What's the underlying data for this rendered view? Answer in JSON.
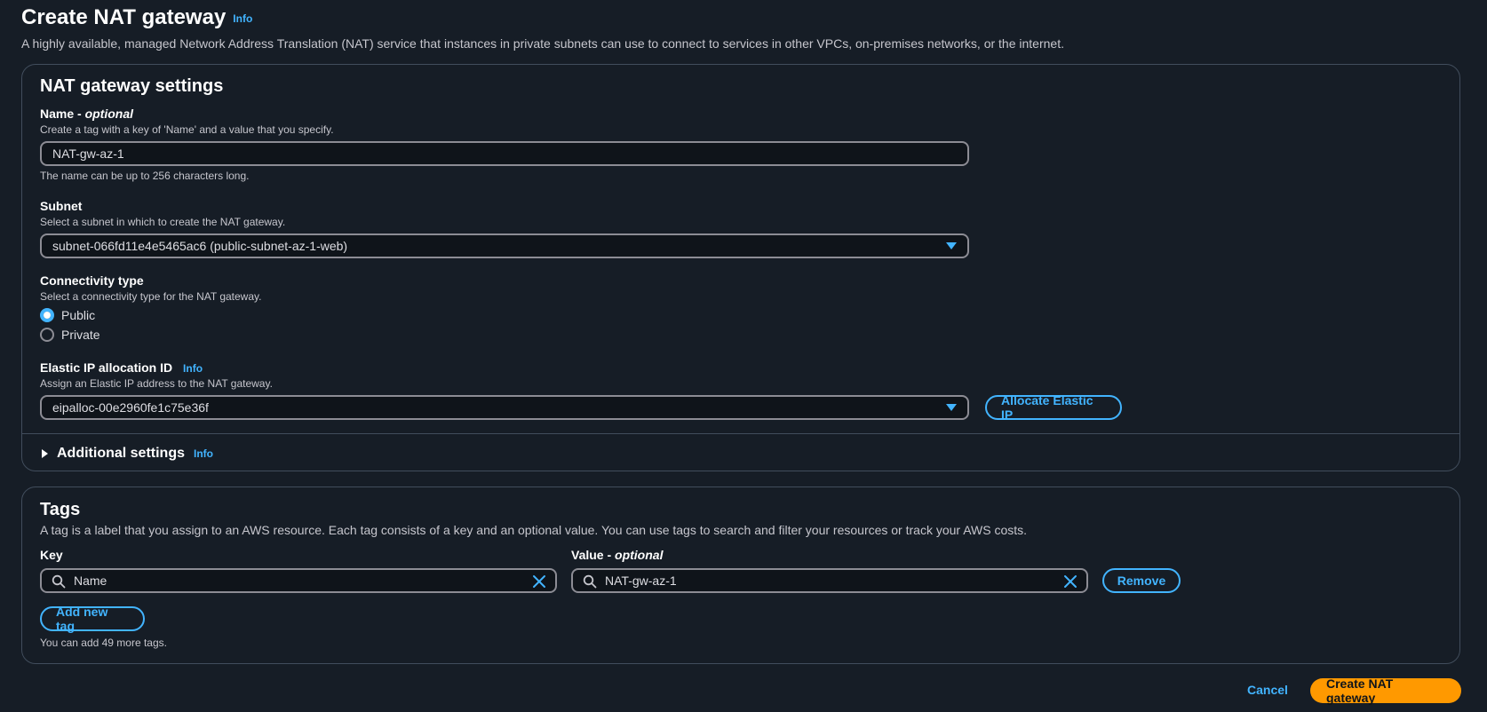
{
  "page": {
    "title": "Create NAT gateway",
    "info": "Info",
    "description": "A highly available, managed Network Address Translation (NAT) service that instances in private subnets can use to connect to services in other VPCs, on-premises networks, or the internet."
  },
  "settings": {
    "heading": "NAT gateway settings",
    "name": {
      "label": "Name - ",
      "label_optional": "optional",
      "description": "Create a tag with a key of 'Name' and a value that you specify.",
      "value": "NAT-gw-az-1",
      "constraint": "The name can be up to 256 characters long."
    },
    "subnet": {
      "label": "Subnet",
      "description": "Select a subnet in which to create the NAT gateway.",
      "value": "subnet-066fd11e4e5465ac6 (public-subnet-az-1-web)"
    },
    "connectivity": {
      "label": "Connectivity type",
      "description": "Select a connectivity type for the NAT gateway.",
      "options": [
        "Public",
        "Private"
      ],
      "selected": "Public"
    },
    "eip": {
      "label": "Elastic IP allocation ID",
      "info": "Info",
      "description": "Assign an Elastic IP address to the NAT gateway.",
      "value": "eipalloc-00e2960fe1c75e36f",
      "allocate_button": "Allocate Elastic IP"
    },
    "additional": {
      "label": "Additional settings",
      "info": "Info"
    }
  },
  "tags": {
    "heading": "Tags",
    "description": "A tag is a label that you assign to an AWS resource. Each tag consists of a key and an optional value. You can use tags to search and filter your resources or track your AWS costs.",
    "key_label": "Key",
    "value_label": "Value - ",
    "value_label_optional": "optional",
    "rows": [
      {
        "key": "Name",
        "value": "NAT-gw-az-1",
        "remove": "Remove"
      }
    ],
    "add_button": "Add new tag",
    "limit_text": "You can add 49 more tags."
  },
  "footer": {
    "cancel": "Cancel",
    "create": "Create NAT gateway"
  },
  "colors": {
    "background": "#161d26",
    "accent": "#42b4ff",
    "primary": "#ff9900"
  }
}
